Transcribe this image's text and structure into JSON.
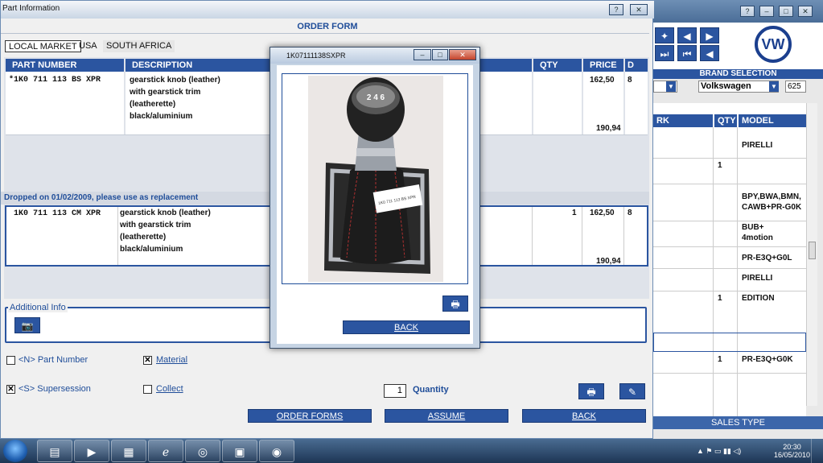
{
  "main_window": {
    "title": "Part Information",
    "help_btn": "?",
    "close_btn": "✕",
    "form_title": "ORDER FORM",
    "tabs": [
      {
        "label": "LOCAL MARKET",
        "active": true
      },
      {
        "label": "USA",
        "active": false
      },
      {
        "label": "SOUTH AFRICA",
        "active": false
      }
    ],
    "columns": {
      "part_number": "PART NUMBER",
      "description": "DESCRIPTION",
      "qty": "QTY",
      "price": "PRICE",
      "d": "D"
    },
    "rows": [
      {
        "part_number": "*1K0 711 113 BS XPR",
        "description": [
          "gearstick knob (leather)",
          "with gearstick trim",
          "(leatherette)",
          "black/aluminium"
        ],
        "qty": "",
        "price": "162,50",
        "d": "8",
        "total": "190,94"
      },
      {
        "part_number": "1K0 711 113 CM XPR",
        "description": [
          "gearstick knob (leather)",
          "with gearstick trim",
          "(leatherette)",
          "black/aluminium"
        ],
        "qty": "1",
        "price": "162,50",
        "d": "8",
        "total": "190,94"
      }
    ],
    "dropped_notice": "Dropped on 01/02/2009, please use as replacement",
    "additional_info": "Additional Info",
    "checkboxes": {
      "part_number": {
        "label": "<N> Part Number",
        "checked": false
      },
      "material": {
        "label": "Material",
        "checked": true
      },
      "supersession": {
        "label": "<S> Supersession",
        "checked": true
      },
      "collect": {
        "label": "Collect",
        "checked": false
      }
    },
    "quantity": {
      "value": "1",
      "label": "Quantity"
    },
    "buttons": {
      "order_forms": "ORDER FORMS",
      "assume": "ASSUME",
      "back": "BACK"
    }
  },
  "popup": {
    "title": "1K07111138SXPR",
    "photo_tag": "1K0 711 113 BS XPR",
    "knob_numbers": "2 4 6",
    "back": "BACK"
  },
  "right_app": {
    "help_btn": "?",
    "brand_selection": "BRAND SELECTION",
    "brand_value": "Volkswagen",
    "brand_code": "625",
    "logo_text": "VW",
    "columns": {
      "rk": "RK",
      "qty": "QTY",
      "model": "MODEL"
    },
    "rows": [
      {
        "qty": "",
        "model": "PIRELLI"
      },
      {
        "qty": "1",
        "model": ""
      },
      {
        "qty": "",
        "model": "BPY,BWA,BMN,\nCAWB+PR-G0K"
      },
      {
        "qty": "",
        "model": "BUB+\n4motion"
      },
      {
        "qty": "",
        "model": "PR-E3Q+G0L"
      },
      {
        "qty": "",
        "model": "PIRELLI"
      },
      {
        "qty": "1",
        "model": "EDITION"
      },
      {
        "qty": "1",
        "model": "PR-E3Q+G0K"
      }
    ],
    "sales_type": "SALES TYPE"
  },
  "taskbar": {
    "time": "20:30",
    "date": "16/05/2010"
  },
  "colors": {
    "accent": "#2b55a0",
    "title_blue": "#1f4d99"
  }
}
